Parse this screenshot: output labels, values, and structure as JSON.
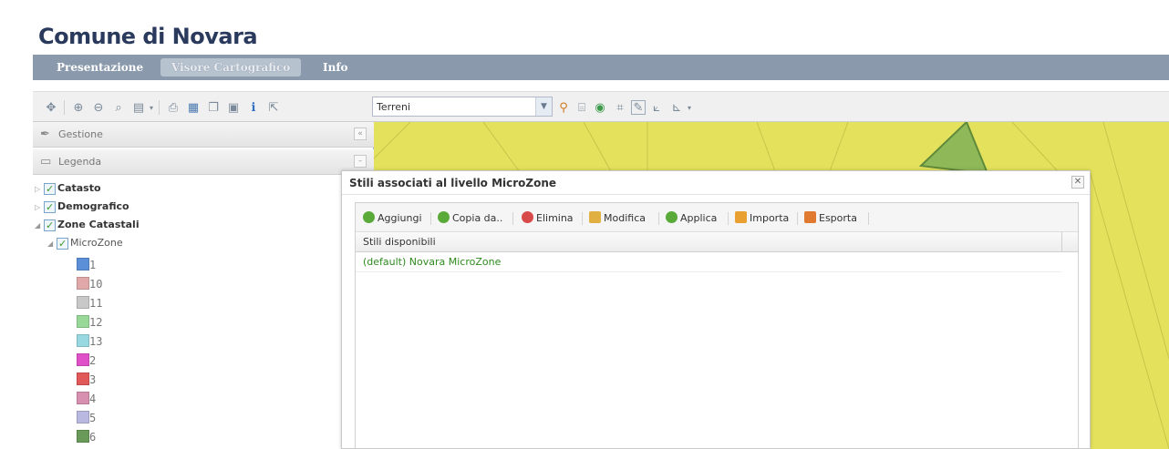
{
  "header": {
    "title": "Comune di Novara"
  },
  "nav": {
    "tabs": [
      "Presentazione",
      "Visore Cartografico",
      "Info"
    ]
  },
  "toolbar": {
    "layer_select_value": "Terreni",
    "icons": [
      "pan-icon",
      "zoom-in-icon",
      "zoom-out-icon",
      "zoom-extent-icon",
      "measure-icon",
      "print-icon",
      "export-icon",
      "copy-icon",
      "document-icon",
      "info-icon",
      "select-icon",
      "pin-icon",
      "query-icon",
      "globe-icon",
      "grid-icon",
      "edit-icon",
      "draw-icon",
      "snap-icon"
    ]
  },
  "left_panel": {
    "gestione_label": "Gestione",
    "legenda_label": "Legenda",
    "tree": {
      "catasto": "Catasto",
      "demografico": "Demografico",
      "zone_catastali": "Zone Catastali",
      "microzone": "MicroZone"
    },
    "legend_items": [
      {
        "label": "1",
        "color": "#5b8fd8"
      },
      {
        "label": "10",
        "color": "#e0a8a8"
      },
      {
        "label": "11",
        "color": "#c8c8c8"
      },
      {
        "label": "12",
        "color": "#98d898"
      },
      {
        "label": "13",
        "color": "#98d8e0"
      },
      {
        "label": "2",
        "color": "#e050c8"
      },
      {
        "label": "3",
        "color": "#e05858"
      },
      {
        "label": "4",
        "color": "#d890b0"
      },
      {
        "label": "5",
        "color": "#b8b8e0"
      },
      {
        "label": "6",
        "color": "#6a9a5a"
      }
    ]
  },
  "map": {
    "fill_color": "#e4e25c"
  },
  "dialog": {
    "title": "Stili associati al livello MicroZone",
    "buttons": {
      "aggiungi": "Aggiungi",
      "copia": "Copia da..",
      "elimina": "Elimina",
      "modifica": "Modifica",
      "applica": "Applica",
      "importa": "Importa",
      "esporta": "Esporta"
    },
    "grid_header": "Stili disponibili",
    "rows": [
      "(default) Novara MicroZone"
    ]
  }
}
